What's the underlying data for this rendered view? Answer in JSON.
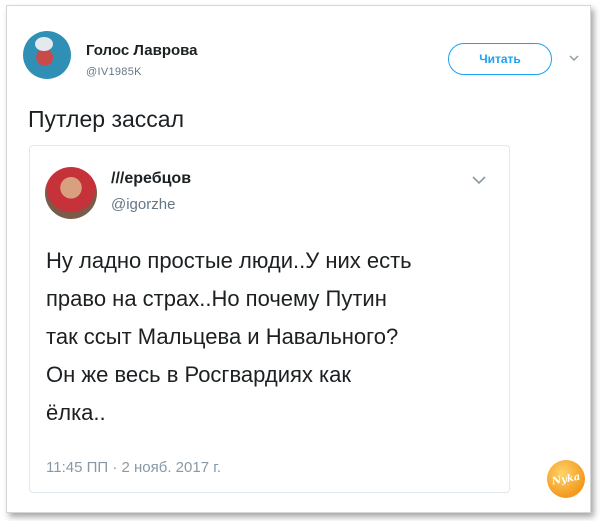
{
  "tweet": {
    "author_name": "Голос Лаврова",
    "author_handle": "@IV1985K",
    "follow_label": "Читать",
    "text": "Путлер зассал"
  },
  "quoted": {
    "author_name": "///еребцов",
    "author_handle": "@igorzhe",
    "text_lines": [
      "Ну ладно простые люди..У них есть",
      "право на страх..Но почему Путин",
      "так ссыт Мальцева и Навального?",
      "Он же весь в Росгвардиях как",
      "ёлка.."
    ],
    "timestamp": "11:45 ПП · 2 нояб. 2017 г."
  },
  "watermark": {
    "text": "Nyka"
  },
  "icons": [
    "avatar",
    "chevron-down-icon",
    "chevron-down-icon",
    "logo"
  ],
  "colors": {
    "accent": "#1da1f2",
    "text": "#1c2022",
    "muted": "#657786"
  }
}
